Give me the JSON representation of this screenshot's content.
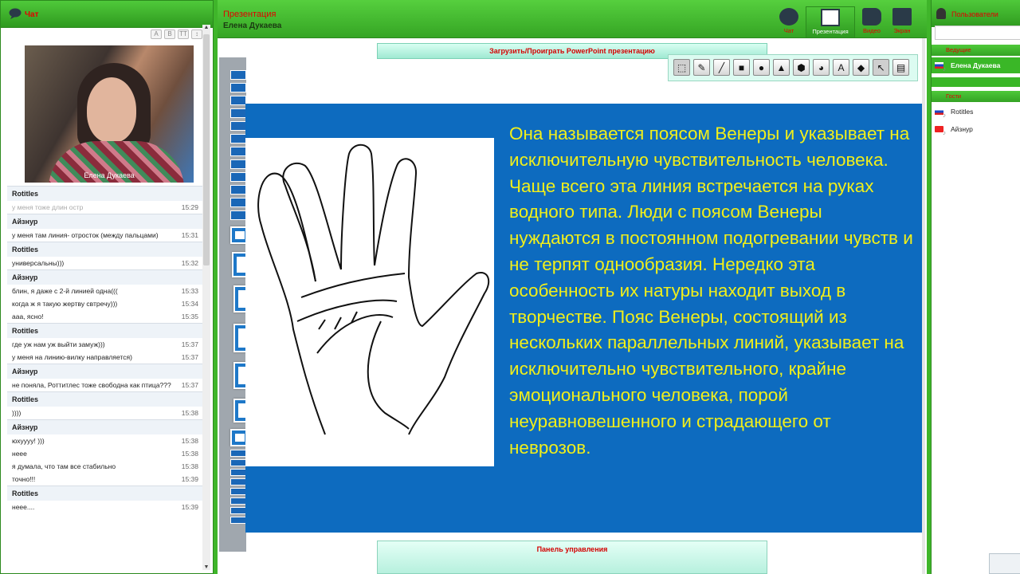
{
  "chat": {
    "title": "Чат",
    "webcam_caption": "Елена Дукаева",
    "toolbar": [
      "A",
      "B",
      "TT",
      "↕"
    ],
    "messages": [
      {
        "user": "Rotitles",
        "lines": [
          {
            "text": "у меня тоже длин остр",
            "time": "15:29",
            "dim": true
          }
        ]
      },
      {
        "user": "Айзнур",
        "lines": [
          {
            "text": "у меня там линия- отросток (между пальцами)",
            "time": "15:31"
          }
        ]
      },
      {
        "user": "Rotitles",
        "lines": [
          {
            "text": "универсальны)))",
            "time": "15:32"
          }
        ]
      },
      {
        "user": "Айзнур",
        "lines": [
          {
            "text": "блин, я даже с 2-й линией одна(((",
            "time": "15:33"
          },
          {
            "text": "когда ж я такую жертву свтречу)))",
            "time": "15:34"
          },
          {
            "text": "ааа, ясно!",
            "time": "15:35"
          }
        ]
      },
      {
        "user": "Rotitles",
        "lines": [
          {
            "text": "где уж нам уж выйти замуж)))",
            "time": "15:37"
          },
          {
            "text": "у меня на линию-вилку направляется)",
            "time": "15:37"
          }
        ]
      },
      {
        "user": "Айзнур",
        "lines": [
          {
            "text": "не поняла, Роттитлес тоже свободна как птица???",
            "time": "15:37"
          }
        ]
      },
      {
        "user": "Rotitles",
        "lines": [
          {
            "text": "))))",
            "time": "15:38"
          }
        ]
      },
      {
        "user": "Айзнур",
        "lines": [
          {
            "text": "юхуууу! )))",
            "time": "15:38"
          },
          {
            "text": "неее",
            "time": "15:38"
          },
          {
            "text": "я думала, что там все стабильно",
            "time": "15:38"
          },
          {
            "text": "точно!!!",
            "time": "15:39"
          }
        ]
      },
      {
        "user": "Rotitles",
        "lines": [
          {
            "text": "нeee....",
            "time": "15:39"
          }
        ]
      }
    ]
  },
  "main": {
    "title": "Презентация",
    "presenter": "Елена Дукаева",
    "top_buttons": [
      {
        "label": "Чат",
        "icon": "speech-bubble-icon"
      },
      {
        "label": "Презентация",
        "icon": "whiteboard-icon",
        "active": true
      },
      {
        "label": "Видео",
        "icon": "video-camera-icon"
      },
      {
        "label": "Экран",
        "icon": "monitor-icon"
      }
    ],
    "upload_bar": "Загрузить/Проиграть PowerPoint презентацию",
    "draw_tools": [
      "select",
      "pencil",
      "line",
      "rectangle",
      "circle",
      "triangle",
      "hexagon",
      "fill",
      "text",
      "eraser",
      "pointer",
      "save"
    ],
    "slide_numbers": [
      "13",
      "14",
      "15",
      "16",
      "17",
      "18",
      "19"
    ],
    "slide_text": "Она называется поясом Венеры  и указывает на исключительную чувствительность человека. Чаще всего эта линия встречается на руках водного типа. Люди с поясом Венеры нуждаются в постоянном подогревании чувств и не терпят однообразия. Нередко эта особенность их натуры находит выход в творчестве. Пояс Венеры, состоящий из нескольких параллельных линий, указывает на исключительно чувствительного, крайне эмоционального человека, порой неуравновешенного и страдающего от неврозов.",
    "control_panel": "Панель управления"
  },
  "users": {
    "title": "Пользователи",
    "section_lead": "Ведущие",
    "section_guests": "Гости",
    "lead": "Елена Дукаева",
    "guests": [
      "Rotitles",
      "Айзнур"
    ]
  },
  "colors": {
    "green": "#3fb52a",
    "slide_bg": "#0d6bbf",
    "slide_text": "#f1ef1a",
    "label_red": "#e10000"
  }
}
